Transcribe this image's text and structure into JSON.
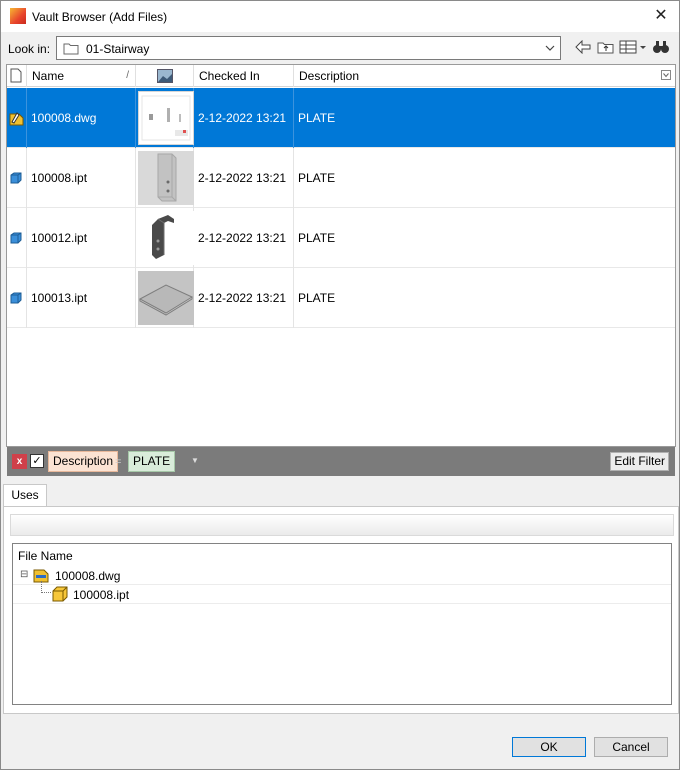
{
  "window": {
    "title": "Vault Browser (Add Files)",
    "close_glyph": "✕"
  },
  "lookin": {
    "label": "Look in:",
    "value": "01-Stairway"
  },
  "toolbar": {
    "icons": [
      "back-icon",
      "up-folder-icon",
      "views-icon",
      "find-icon"
    ]
  },
  "grid": {
    "columns": {
      "name": "Name",
      "sort_glyph": "/",
      "checked_in": "Checked In",
      "description": "Description"
    },
    "rows": [
      {
        "name": "100008.dwg",
        "checked_in": "2-12-2022 13:21",
        "description": "PLATE",
        "type": "dwg",
        "selected": true
      },
      {
        "name": "100008.ipt",
        "checked_in": "2-12-2022 13:21",
        "description": "PLATE",
        "type": "ipt",
        "selected": false
      },
      {
        "name": "100012.ipt",
        "checked_in": "2-12-2022 13:21",
        "description": "PLATE",
        "type": "ipt",
        "selected": false
      },
      {
        "name": "100013.ipt",
        "checked_in": "2-12-2022 13:21",
        "description": "PLATE",
        "type": "ipt",
        "selected": false
      }
    ]
  },
  "filter": {
    "remove": "x",
    "checked": true,
    "property": "Description",
    "operator": "=",
    "value": "PLATE",
    "edit_label": "Edit Filter"
  },
  "tabs": {
    "uses": "Uses"
  },
  "uses_tree": {
    "header": "File Name",
    "items": [
      {
        "name": "100008.dwg",
        "expander": "⊟"
      },
      {
        "name": "100008.ipt"
      }
    ]
  },
  "buttons": {
    "ok": "OK",
    "cancel": "Cancel"
  },
  "colors": {
    "selection": "#0078d7",
    "filter_bar": "#7b7b7b",
    "remove_filter": "#d0404a"
  }
}
